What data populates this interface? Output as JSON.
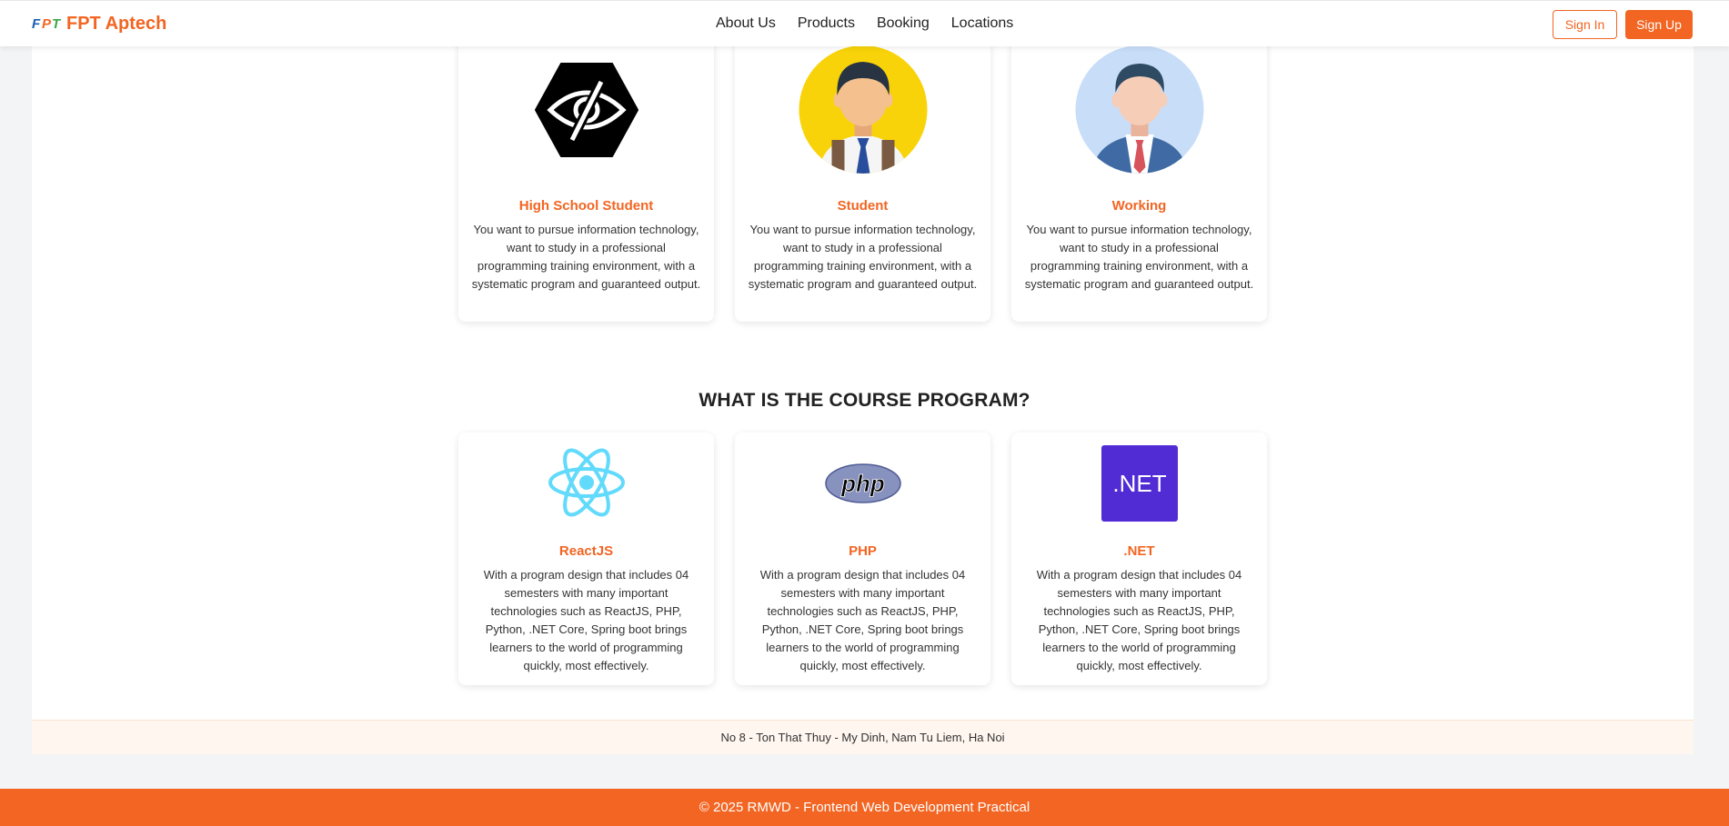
{
  "brand": {
    "name": "FPT Aptech"
  },
  "nav": {
    "items": [
      "About Us",
      "Products",
      "Booking",
      "Locations"
    ]
  },
  "auth": {
    "signin_label": "Sign In",
    "signup_label": "Sign Up"
  },
  "audience": {
    "cards": [
      {
        "title": "High School Student",
        "desc": "You want to pursue information technology, want to study in a professional programming training environment, with a systematic program and guaranteed output.",
        "icon": "eye-slash-icon"
      },
      {
        "title": "Student",
        "desc": "You want to pursue information technology, want to study in a professional programming training environment, with a systematic program and guaranteed output.",
        "icon": "student-avatar-icon"
      },
      {
        "title": "Working",
        "desc": "You want to pursue information technology, want to study in a professional programming training environment, with a systematic program and guaranteed output.",
        "icon": "businessman-avatar-icon"
      }
    ]
  },
  "courses": {
    "heading": "WHAT IS THE COURSE PROGRAM?",
    "cards": [
      {
        "title": "ReactJS",
        "desc": "With a program design that includes 04 semesters with many important technologies such as ReactJS, PHP, Python, .NET Core, Spring boot brings learners to the world of programming quickly, most effectively.",
        "icon": "react-icon"
      },
      {
        "title": "PHP",
        "desc": "With a program design that includes 04 semesters with many important technologies such as ReactJS, PHP, Python, .NET Core, Spring boot brings learners to the world of programming quickly, most effectively.",
        "icon": "php-icon",
        "logo_text": "php"
      },
      {
        "title": ".NET",
        "desc": "With a program design that includes 04 semesters with many important technologies such as ReactJS, PHP, Python, .NET Core, Spring boot brings learners to the world of programming quickly, most effectively.",
        "icon": "dotnet-icon",
        "logo_text": ".NET"
      }
    ]
  },
  "address": "No 8 - Ton That Thuy - My Dinh, Nam Tu Liem, Ha Noi",
  "footer": {
    "copyright": "© 2025 RMWD - Frontend Web Development Practical"
  },
  "colors": {
    "accent": "#f26522",
    "dotnet": "#512bd4",
    "react": "#61dafb",
    "php": "#8892bf"
  }
}
